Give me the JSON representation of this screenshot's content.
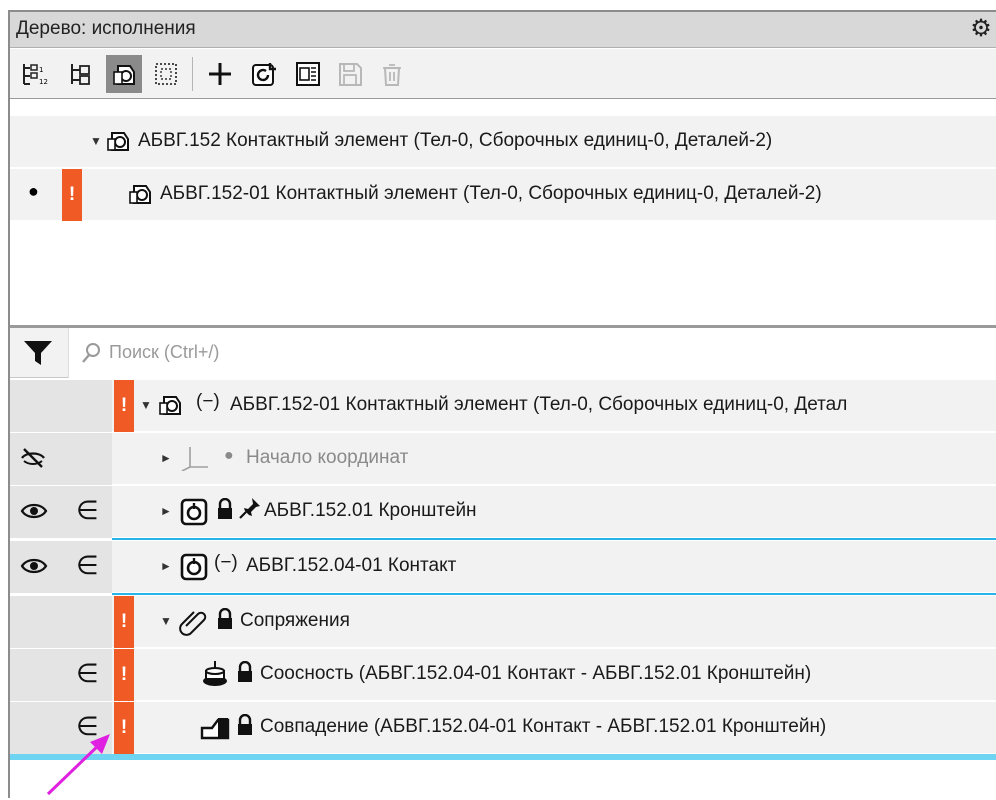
{
  "window": {
    "title": "Дерево: исполнения"
  },
  "toolbar": {
    "buttons": [
      "tree-numbered-icon",
      "tree-structure-icon",
      "assembly-view-icon",
      "select-frame-icon",
      "add-icon",
      "refresh-icon",
      "properties-icon",
      "save-icon",
      "delete-icon"
    ],
    "active": "assembly-view-icon"
  },
  "variants": [
    {
      "label": "АБВГ.152 Контактный элемент (Тел-0, Сборочных единиц-0, Деталей-2)",
      "expanded": true
    },
    {
      "label": "АБВГ.152-01 Контактный элемент (Тел-0, Сборочных единиц-0, Деталей-2)",
      "current": true,
      "warning": "!",
      "bullet": "●"
    }
  ],
  "search": {
    "placeholder": "Поиск (Ctrl+/)"
  },
  "tree": {
    "root": {
      "label": "АБВГ.152-01 Контактный элемент (Тел-0, Сборочных единиц-0, Детал",
      "prefix": "(−)",
      "warning": "!"
    },
    "items": [
      {
        "label": "Начало координат",
        "hidden": true
      },
      {
        "label": "АБВГ.152.01 Кронштейн",
        "member": "∈"
      },
      {
        "label": "АБВГ.152.04-01 Контакт",
        "prefix": "(−)",
        "member": "∈"
      },
      {
        "label": "Сопряжения",
        "warning": "!"
      },
      {
        "label": "Соосность (АБВГ.152.04-01 Контакт  -  АБВГ.152.01 Кронштейн)",
        "member": "∈",
        "warning": "!"
      },
      {
        "label": "Совпадение (АБВГ.152.04-01 Контакт  -  АБВГ.152.01 Кронштейн)",
        "member": "∈",
        "warning": "!"
      }
    ]
  },
  "colors": {
    "warning": "#f05a24",
    "selection": "#28b4e8",
    "annotation_arrow": "#e020e0"
  }
}
